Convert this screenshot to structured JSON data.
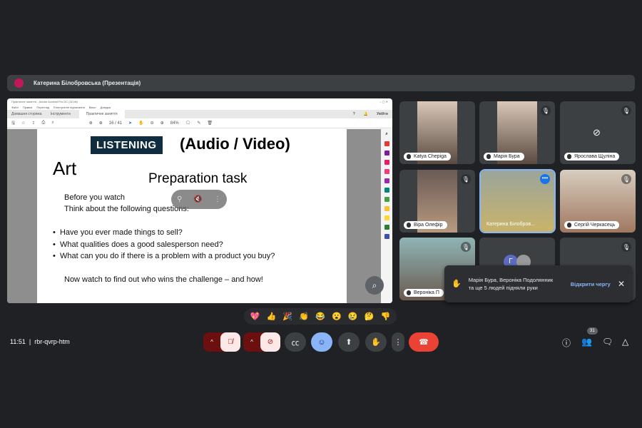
{
  "header": {
    "presenter": "Катерина Білобровська (Презентація)"
  },
  "acrobat": {
    "title": "Практичне заняття - Adobe Acrobat Pro DC (32-bit)",
    "menu": [
      "Файл",
      "Правка",
      "Перегляд",
      "Електронне підписання",
      "Вікно",
      "Довідка"
    ],
    "tabs": [
      "Домашня сторінка",
      "Інструменти",
      "Практичне заняття"
    ],
    "signin": "Увійти",
    "page_indicator": "16 / 41",
    "zoom": "84%"
  },
  "slide": {
    "badge": "LISTENING",
    "subtitle": "(Audio / Video)",
    "topic": "Art",
    "heading": "Preparation task",
    "intro1": "Before you watch",
    "intro2": "Think about the following questions:",
    "bullets": [
      "Have you ever made things to sell?",
      "What qualities does a good salesperson need?",
      "What can you do if there is a problem with a product you buy?"
    ],
    "closing": "Now watch to find out who wins the challenge – and how!"
  },
  "participants": [
    {
      "name": "Katya Chepiga"
    },
    {
      "name": "Марія Бура"
    },
    {
      "name": "Ярослава Щуліна"
    },
    {
      "name": "Віра Олефір"
    },
    {
      "name": "Катерина Білобров..."
    },
    {
      "name": "Сергій Черкасець"
    },
    {
      "name": "Вероніка П"
    },
    {
      "initial": "Г"
    }
  ],
  "notification": {
    "message": "Марія Бура, Вероніка Подолянник та ще 5 людей підняли руки",
    "action": "Відкрити чергу"
  },
  "reactions": [
    "💖",
    "👍",
    "🎉",
    "👏",
    "😂",
    "😮",
    "😢",
    "🤔",
    "👎"
  ],
  "bottom": {
    "time": "11:51",
    "meeting_code": "rbr-qvrp-htm",
    "participant_count": "31"
  },
  "colors": {
    "background": "#202124",
    "end_call": "#ea4335",
    "accent": "#8ab4f8"
  }
}
